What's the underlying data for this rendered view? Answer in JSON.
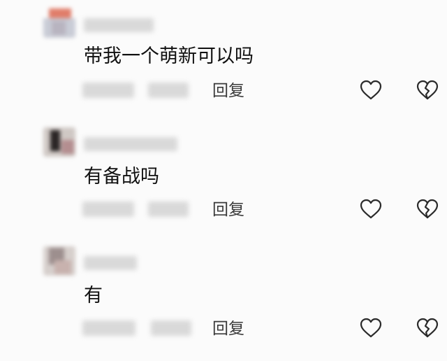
{
  "comments": [
    {
      "text": "带我一个萌新可以吗",
      "reply_label": "回复",
      "like_icon": "heart-outline-icon",
      "dislike_icon": "broken-heart-icon"
    },
    {
      "text": "有备战吗",
      "reply_label": "回复",
      "like_icon": "heart-outline-icon",
      "dislike_icon": "broken-heart-icon"
    },
    {
      "text": "有",
      "reply_label": "回复",
      "like_icon": "heart-outline-icon",
      "dislike_icon": "broken-heart-icon"
    }
  ],
  "colors": {
    "background": "#fbfbfb",
    "text": "#111111",
    "icon_stroke": "#2a2a2a",
    "redacted_blur": "#d9d9d9"
  }
}
